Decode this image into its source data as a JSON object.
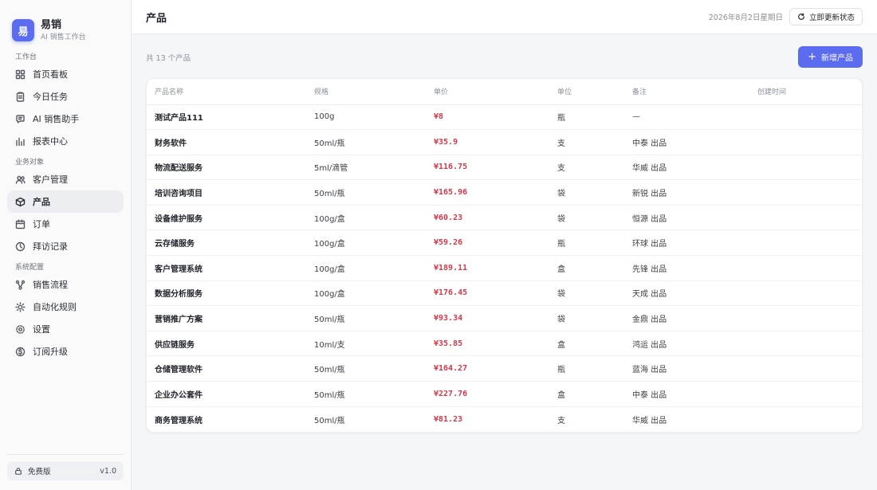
{
  "brand": {
    "logo_char": "易",
    "name": "易销",
    "subtitle": "AI 销售工作台"
  },
  "sidebar": {
    "groups": [
      {
        "title": "工作台",
        "items": [
          {
            "label": "首页看板",
            "icon": "dashboard-icon"
          },
          {
            "label": "今日任务",
            "icon": "clipboard-icon"
          },
          {
            "label": "AI 销售助手",
            "icon": "chat-icon"
          },
          {
            "label": "报表中心",
            "icon": "bar-chart-icon"
          }
        ]
      },
      {
        "title": "业务对象",
        "items": [
          {
            "label": "客户管理",
            "icon": "users-icon"
          },
          {
            "label": "产品",
            "icon": "box-icon",
            "active": true
          },
          {
            "label": "订单",
            "icon": "calendar-icon"
          },
          {
            "label": "拜访记录",
            "icon": "clock-icon"
          }
        ]
      },
      {
        "title": "系统配置",
        "items": [
          {
            "label": "销售流程",
            "icon": "workflow-icon"
          },
          {
            "label": "自动化规则",
            "icon": "sun-icon"
          },
          {
            "label": "设置",
            "icon": "gear-icon"
          },
          {
            "label": "订阅升级",
            "icon": "coin-icon"
          }
        ]
      }
    ],
    "plan": {
      "label": "免费版",
      "version": "v1.0"
    }
  },
  "header": {
    "title": "产品",
    "date": "2026年8月2日星期日",
    "refresh_label": "立即更新状态"
  },
  "toolbar": {
    "count_text": "共 13 个产品",
    "add_label": "新增产品"
  },
  "table": {
    "columns": [
      "产品名称",
      "规格",
      "单价",
      "单位",
      "备注",
      "创建时间"
    ],
    "rows": [
      [
        "测试产品111",
        "100g",
        "¥8",
        "瓶",
        "—",
        ""
      ],
      [
        "财务软件",
        "50ml/瓶",
        "¥35.9",
        "支",
        "中泰 出品",
        ""
      ],
      [
        "物流配送服务",
        "5ml/滴管",
        "¥116.75",
        "支",
        "华威 出品",
        ""
      ],
      [
        "培训咨询项目",
        "50ml/瓶",
        "¥165.96",
        "袋",
        "新锐 出品",
        ""
      ],
      [
        "设备维护服务",
        "100g/盒",
        "¥60.23",
        "袋",
        "恒源 出品",
        ""
      ],
      [
        "云存储服务",
        "100g/盒",
        "¥59.26",
        "瓶",
        "环球 出品",
        ""
      ],
      [
        "客户管理系统",
        "100g/盒",
        "¥189.11",
        "盒",
        "先锋 出品",
        ""
      ],
      [
        "数据分析服务",
        "100g/盒",
        "¥176.45",
        "袋",
        "天成 出品",
        ""
      ],
      [
        "营销推广方案",
        "50ml/瓶",
        "¥93.34",
        "袋",
        "金鼎 出品",
        ""
      ],
      [
        "供应链服务",
        "10ml/支",
        "¥35.85",
        "盒",
        "鸿运 出品",
        ""
      ],
      [
        "仓储管理软件",
        "50ml/瓶",
        "¥164.27",
        "瓶",
        "蓝海 出品",
        ""
      ],
      [
        "企业办公套件",
        "50ml/瓶",
        "¥227.76",
        "盒",
        "中泰 出品",
        ""
      ],
      [
        "商务管理系统",
        "50ml/瓶",
        "¥81.23",
        "支",
        "华威 出品",
        ""
      ]
    ]
  },
  "colors": {
    "accent": "#5b6cf0",
    "price": "#d4374a"
  }
}
